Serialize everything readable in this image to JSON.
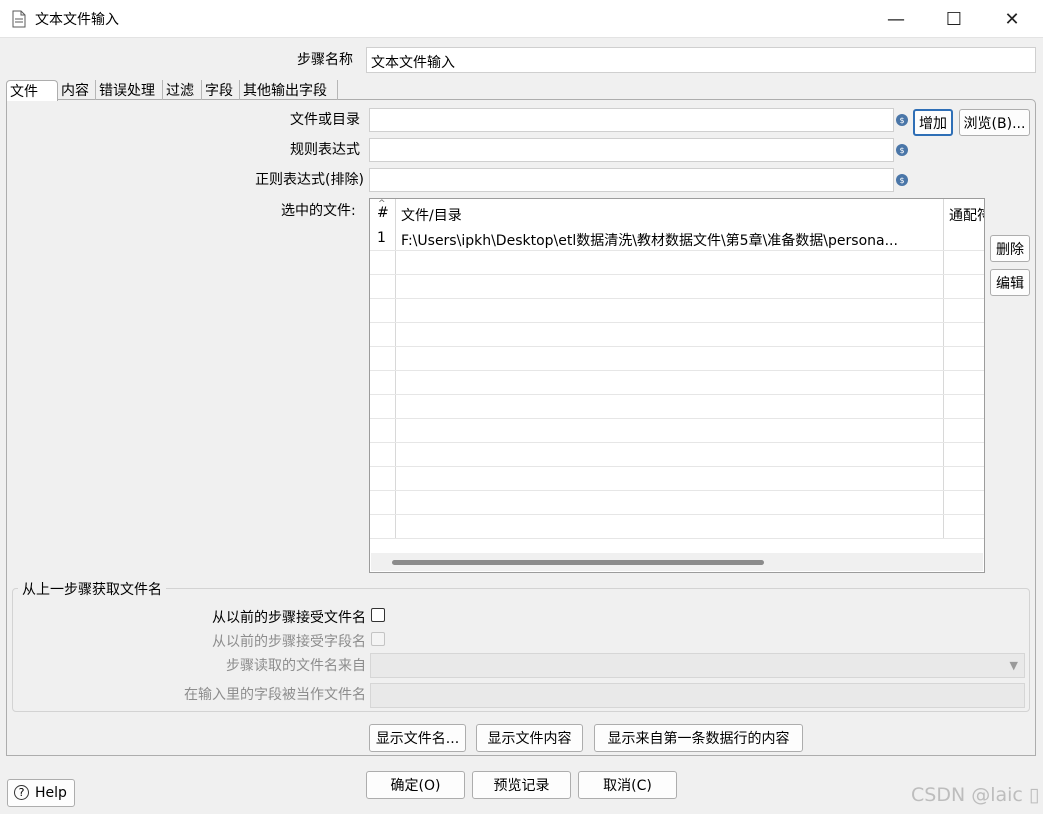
{
  "window": {
    "title": "文本文件输入",
    "minimize": "—",
    "maximize": "☐",
    "close": "✕"
  },
  "step_name": {
    "label": "步骤名称",
    "value": "文本文件输入"
  },
  "tabs": [
    {
      "label": "文件",
      "active": true
    },
    {
      "label": "内容"
    },
    {
      "label": "错误处理"
    },
    {
      "label": "过滤"
    },
    {
      "label": "字段"
    },
    {
      "label": "其他输出字段"
    }
  ],
  "file_tab": {
    "file_or_dir_label": "文件或目录",
    "regex_label": "规则表达式",
    "regex_exclude_label": "正则表达式(排除)",
    "add_button": "增加",
    "browse_button": "浏览(B)...",
    "variable_icon": "$",
    "selected_files_label": "选中的文件:",
    "delete_button": "删除",
    "edit_button": "编辑",
    "table": {
      "sort_indicator": "^",
      "headers": [
        "#",
        "文件/目录",
        "通配符"
      ],
      "rows": [
        {
          "num": "1",
          "path": "F:\\Users\\ipkh\\Desktop\\etl数据清洗\\教材数据文件\\第5章\\准备数据\\persona..."
        }
      ]
    }
  },
  "prev_step": {
    "group_title": "从上一步骤获取文件名",
    "accept_filenames_label": "从以前的步骤接受文件名",
    "accept_fields_label": "从以前的步骤接受字段名",
    "filename_from_label": "步骤读取的文件名来自",
    "field_as_filename_label": "在输入里的字段被当作文件名",
    "dropdown_arrow": "▼"
  },
  "actions": {
    "show_filenames": "显示文件名...",
    "show_file_content": "显示文件内容",
    "show_first_row": "显示来自第一条数据行的内容"
  },
  "footer": {
    "help": "Help",
    "help_icon": "?",
    "ok": "确定(O)",
    "preview": "预览记录",
    "cancel": "取消(C)",
    "watermark": "CSDN @laic ▯"
  }
}
